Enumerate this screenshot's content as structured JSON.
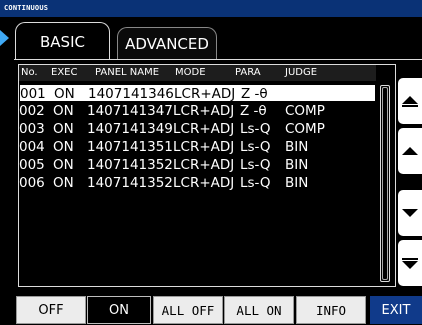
{
  "window": {
    "title": "CONTINUOUS"
  },
  "tabs": [
    {
      "label": "BASIC",
      "selected": true
    },
    {
      "label": "ADVANCED",
      "selected": false
    }
  ],
  "table": {
    "columns": [
      "No.",
      "EXEC",
      "PANEL NAME",
      "MODE",
      "PARA",
      "JUDGE"
    ],
    "rows": [
      {
        "no": "001",
        "exec": "ON",
        "panel": "1407141346",
        "mode": "LCR+ADJ",
        "para": "Z -θ",
        "judge": ""
      },
      {
        "no": "002",
        "exec": "ON",
        "panel": "1407141347",
        "mode": "LCR+ADJ",
        "para": "Z -θ",
        "judge": "COMP"
      },
      {
        "no": "003",
        "exec": "ON",
        "panel": "1407141349",
        "mode": "LCR+ADJ",
        "para": "Ls-Q",
        "judge": "COMP"
      },
      {
        "no": "004",
        "exec": "ON",
        "panel": "1407141351",
        "mode": "LCR+ADJ",
        "para": "Ls-Q",
        "judge": "BIN"
      },
      {
        "no": "005",
        "exec": "ON",
        "panel": "1407141352",
        "mode": "LCR+ADJ",
        "para": "Ls-Q",
        "judge": "BIN"
      },
      {
        "no": "006",
        "exec": "ON",
        "panel": "1407141352",
        "mode": "LCR+ADJ",
        "para": "Ls-Q",
        "judge": "BIN"
      }
    ],
    "selected_index": 0
  },
  "scroll_buttons": [
    {
      "name": "scroll-page-up",
      "icon": "page-up-icon"
    },
    {
      "name": "scroll-line-up",
      "icon": "line-up-icon"
    },
    {
      "name": "scroll-line-down",
      "icon": "line-down-icon"
    },
    {
      "name": "scroll-page-down",
      "icon": "page-down-icon"
    }
  ],
  "buttons": {
    "off": "OFF",
    "on": "ON",
    "all_off": "ALL OFF",
    "all_on": "ALL ON",
    "info": "INFO",
    "exit": "EXIT"
  },
  "colors": {
    "title_bar": "#0a3276",
    "exit_button": "#103a8a",
    "active_marker": "#3fa9f5"
  }
}
